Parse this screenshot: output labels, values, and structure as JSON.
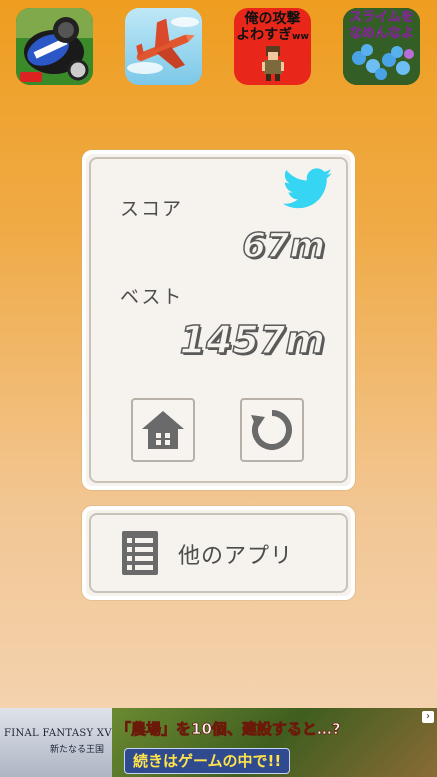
{
  "app_icons": [
    {
      "name": "kart racing app",
      "icon": "kart-icon"
    },
    {
      "name": "airplane app",
      "icon": "airplane-icon"
    },
    {
      "name": "weak attack game",
      "icon": "pixel-hero-icon",
      "title_line1": "俺の攻撃",
      "title_line2": "よわすぎ",
      "title_suffix": "ww"
    },
    {
      "name": "slime game",
      "icon": "slime-icon",
      "title_line1": "スライムを",
      "title_line2": "なめんなよ"
    }
  ],
  "result": {
    "score_label": "スコア",
    "score_value": "67m",
    "best_label": "ベスト",
    "best_value": "1457m"
  },
  "buttons": {
    "share_icon": "twitter-icon",
    "home_icon": "home-icon",
    "retry_icon": "retry-icon"
  },
  "other_apps": {
    "label": "他のアプリ",
    "icon": "list-icon"
  },
  "ad": {
    "brand": "FINAL FANTASY XV",
    "brand_sub": "新たなる王国",
    "headline": "「農場」を10個、建設すると…?",
    "subline": "続きはゲームの中で!!"
  },
  "colors": {
    "twitter": "#35d5f3",
    "panel": "#f6f3ee",
    "icon_gray": "#6a6a6a"
  }
}
